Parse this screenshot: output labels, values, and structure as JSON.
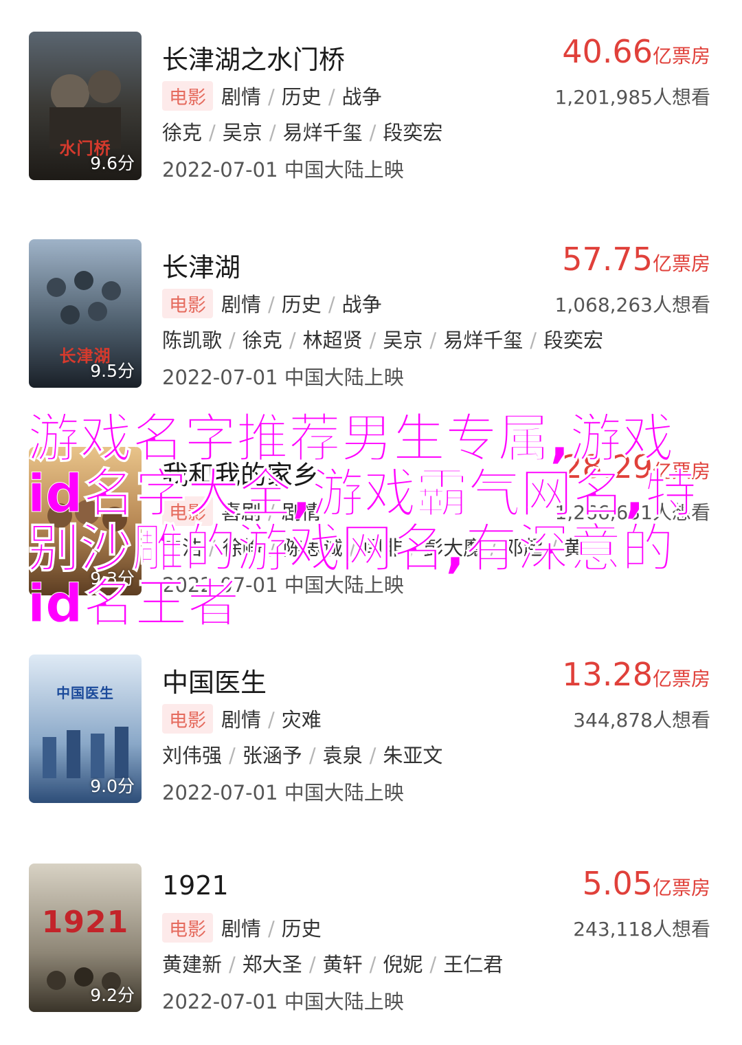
{
  "overlay_text": "游戏名字推荐男生专属,游戏id名字大全,游戏霸气网名,特别沙雕的游戏网名,有深意的id名王者",
  "colors": {
    "accent": "#e0403a",
    "tag_bg": "#fdeaea",
    "overlay": "#ff00ff"
  },
  "movies": [
    {
      "title": "长津湖之水门桥",
      "poster_text": "水门桥",
      "score": "9.6分",
      "box_office": "40.66",
      "box_office_unit": "亿票房",
      "tag": "电影",
      "genres": [
        "剧情",
        "历史",
        "战争"
      ],
      "wants": "1,201,985人想看",
      "cast": [
        "徐克",
        "吴京",
        "易烊千玺",
        "段奕宏"
      ],
      "release": "2022-07-01 中国大陆上映"
    },
    {
      "title": "长津湖",
      "poster_text": "长津湖",
      "score": "9.5分",
      "box_office": "57.75",
      "box_office_unit": "亿票房",
      "tag": "电影",
      "genres": [
        "剧情",
        "历史",
        "战争"
      ],
      "wants": "1,068,263人想看",
      "cast": [
        "陈凯歌",
        "徐克",
        "林超贤",
        "吴京",
        "易烊千玺",
        "段奕宏"
      ],
      "release": "2022-07-01 中国大陆上映"
    },
    {
      "title": "我和我的家乡",
      "poster_text": "",
      "score": "9.3分",
      "box_office": "28.29",
      "box_office_unit": "亿票房",
      "tag": "电影",
      "genres": [
        "喜剧",
        "剧情"
      ],
      "wants": "1,266,631人想看",
      "cast": [
        "宁浩",
        "徐峥",
        "陈思诚",
        "闫非",
        "彭大魔",
        "邓超",
        "黄..."
      ],
      "release": "2022-07-01 中国大陆上映"
    },
    {
      "title": "中国医生",
      "poster_text": "中国医生",
      "score": "9.0分",
      "box_office": "13.28",
      "box_office_unit": "亿票房",
      "tag": "电影",
      "genres": [
        "剧情",
        "灾难"
      ],
      "wants": "344,878人想看",
      "cast": [
        "刘伟强",
        "张涵予",
        "袁泉",
        "朱亚文"
      ],
      "release": "2022-07-01 中国大陆上映"
    },
    {
      "title": "1921",
      "poster_text": "1921",
      "score": "9.2分",
      "box_office": "5.05",
      "box_office_unit": "亿票房",
      "tag": "电影",
      "genres": [
        "剧情",
        "历史"
      ],
      "wants": "243,118人想看",
      "cast": [
        "黄建新",
        "郑大圣",
        "黄轩",
        "倪妮",
        "王仁君"
      ],
      "release": "2022-07-01 中国大陆上映"
    }
  ]
}
